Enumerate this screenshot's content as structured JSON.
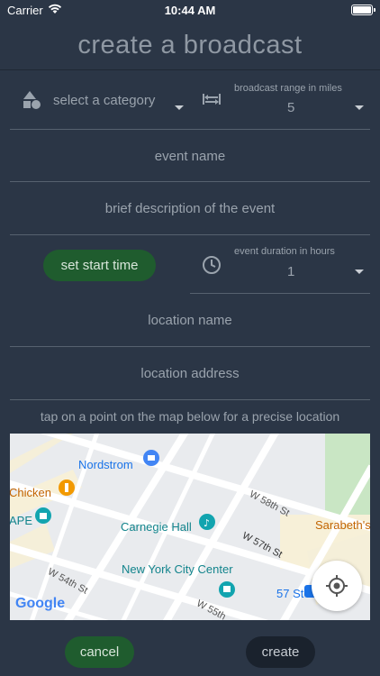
{
  "status_bar": {
    "carrier": "Carrier",
    "time": "10:44 AM"
  },
  "header": {
    "title": "create a broadcast"
  },
  "category": {
    "placeholder": "select a category",
    "icon": "shapes-icon"
  },
  "range": {
    "label": "broadcast range in miles",
    "value": "5",
    "icon": "range-arrows-icon"
  },
  "event_name": {
    "placeholder": "event name"
  },
  "description": {
    "placeholder": "brief description of the event"
  },
  "start_time": {
    "label": "set start time"
  },
  "duration": {
    "label": "event duration in hours",
    "value": "1",
    "icon": "clock-icon"
  },
  "location_name": {
    "placeholder": "location name"
  },
  "location_address": {
    "placeholder": "location address"
  },
  "map_hint": "tap on a point on the map below for a precise location",
  "map": {
    "places": [
      "Nordstrom",
      "Chicken",
      "APE",
      "Carnegie Hall",
      "New York City Center",
      "Sarabeth's",
      "57 St"
    ],
    "streets": [
      "W 58th St",
      "W 57th St",
      "W 54th St",
      "W 55th"
    ],
    "attribution": "Google"
  },
  "actions": {
    "cancel": "cancel",
    "create": "create"
  },
  "colors": {
    "background": "#2b3646",
    "button_green": "#1f5c2e",
    "button_dark": "#1a222d"
  }
}
